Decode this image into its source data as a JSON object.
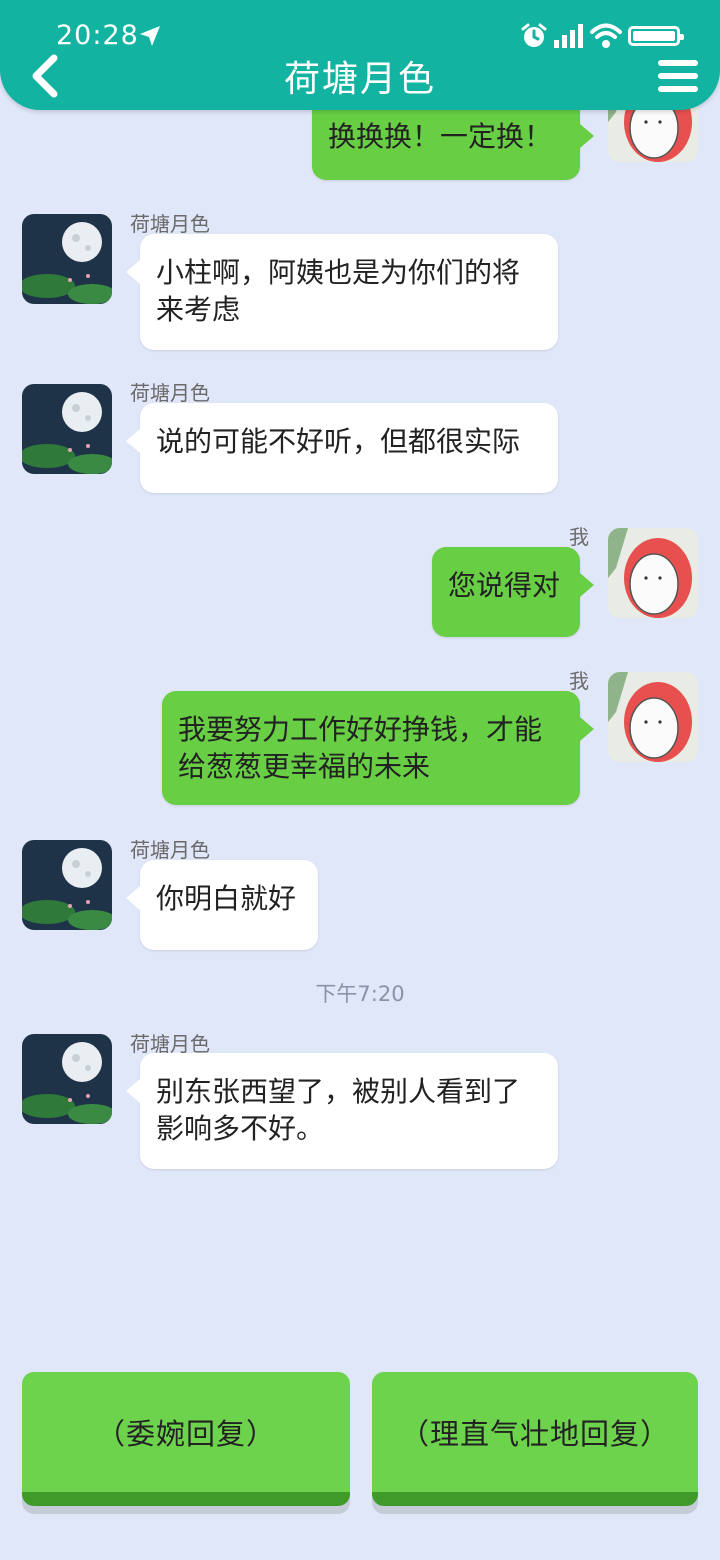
{
  "status_bar": {
    "time": "20:28"
  },
  "header": {
    "title": "荷塘月色"
  },
  "messages": [
    {
      "side": "out",
      "sender": "",
      "text": "换换换！一定换！"
    },
    {
      "side": "in",
      "sender": "荷塘月色",
      "text": "小柱啊，阿姨也是为你们的将来考虑"
    },
    {
      "side": "in",
      "sender": "荷塘月色",
      "text": "说的可能不好听，但都很实际"
    },
    {
      "side": "out",
      "sender": "我",
      "text": "您说得对"
    },
    {
      "side": "out",
      "sender": "我",
      "text": "我要努力工作好好挣钱，才能给葱葱更幸福的未来"
    },
    {
      "side": "in",
      "sender": "荷塘月色",
      "text": "你明白就好"
    },
    {
      "side": "in",
      "sender": "荷塘月色",
      "text": "别东张西望了，被别人看到了影响多不好。"
    }
  ],
  "timestamp": "下午7:20",
  "choices": [
    {
      "label": "（委婉回复）"
    },
    {
      "label": "（理直气壮地回复）"
    }
  ],
  "colors": {
    "header": "#12b3a0",
    "background": "#e0e7f9",
    "outgoing_bubble": "#68cf45",
    "incoming_bubble": "#ffffff"
  }
}
